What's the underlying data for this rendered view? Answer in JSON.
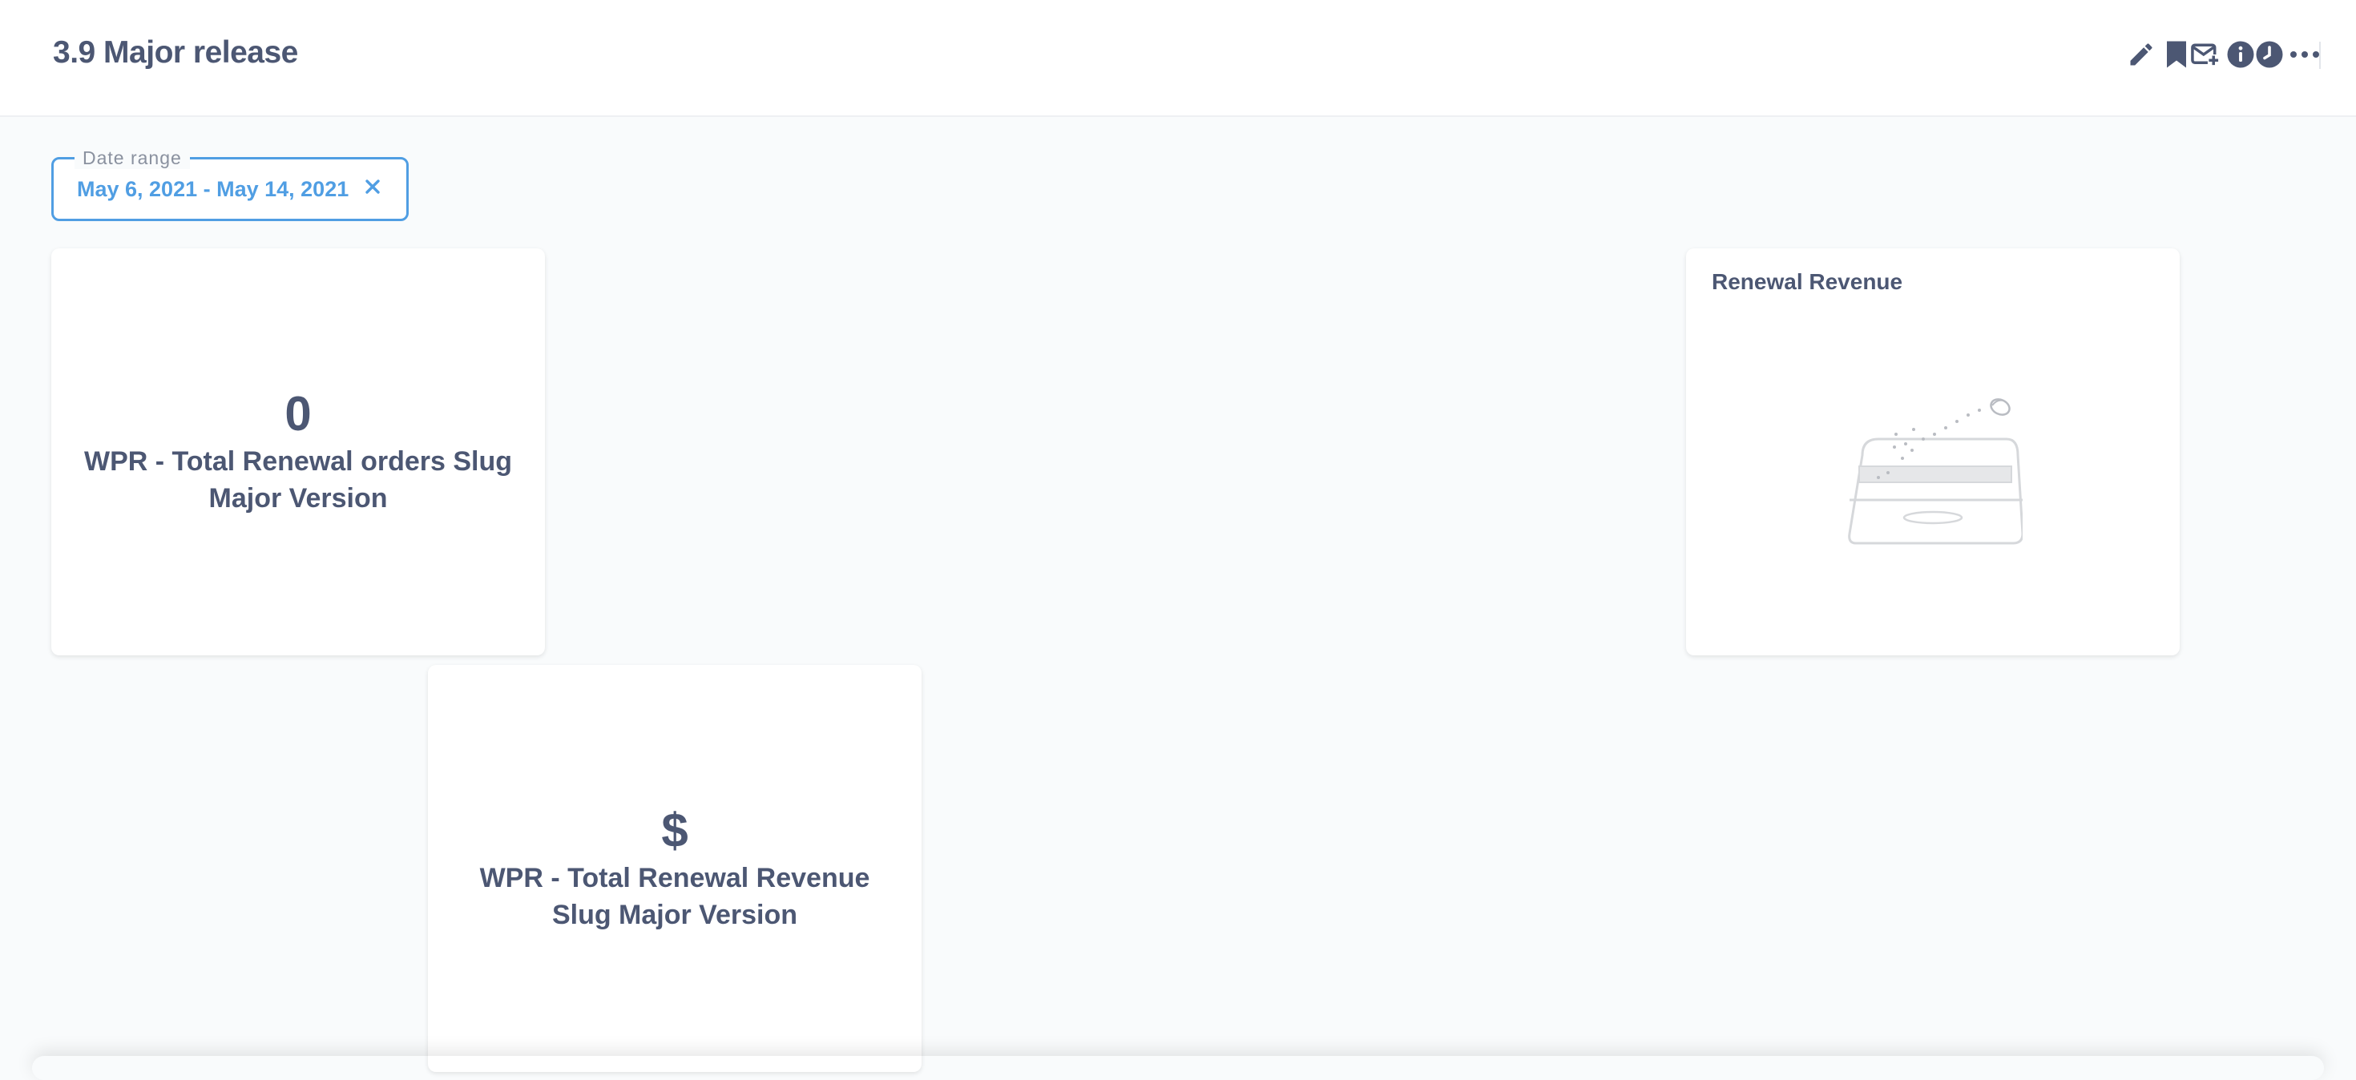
{
  "dashboard": {
    "title": "3.9 Major release"
  },
  "header": {
    "actions": [
      {
        "icon": "pencil-icon",
        "label": "Edit dashboard"
      },
      {
        "icon": "subscription-icon",
        "label": "Subscriptions"
      },
      {
        "icon": "clock-icon",
        "label": "Auto-refresh"
      },
      {
        "icon": "bookmark-icon",
        "label": "Bookmark"
      },
      {
        "icon": "info-icon",
        "label": "More info"
      },
      {
        "icon": "ellipsis-icon",
        "label": "More options"
      }
    ]
  },
  "filter": {
    "label": "Date range",
    "value": "May 6, 2021 - May 14, 2021",
    "accent": "#509ee3"
  },
  "cards": {
    "orders": {
      "value": "0",
      "title": "WPR - Total Renewal orders Slug Major Version"
    },
    "revenue_chart": {
      "title": "Renewal Revenue",
      "state": "empty",
      "icon": "empty-box-illustration"
    },
    "revenue": {
      "value": "$",
      "title": "WPR - Total Renewal Revenue Slug Major Version"
    }
  },
  "colors": {
    "text": "#4c5773",
    "brand": "#509ee3",
    "background": "#f9fbfc"
  }
}
